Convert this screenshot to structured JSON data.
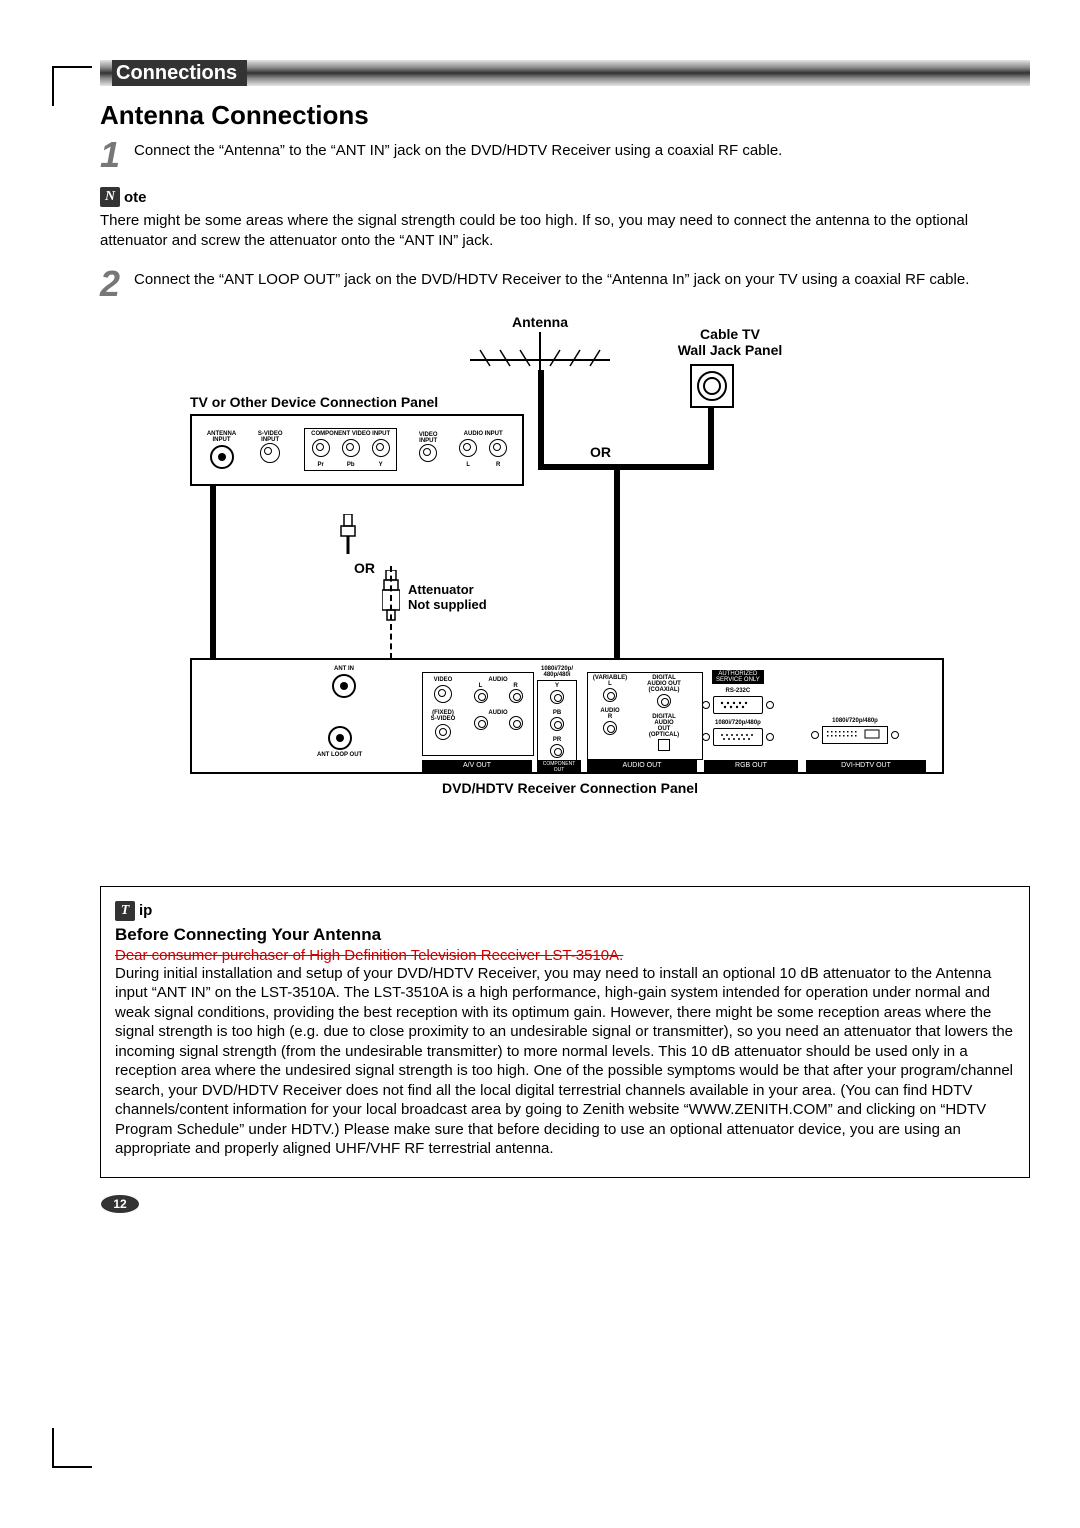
{
  "section_header": "Connections",
  "title": "Antenna Connections",
  "steps": [
    {
      "num": "1",
      "text": "Connect the “Antenna” to the “ANT IN” jack on the DVD/HDTV Receiver using a coaxial RF cable."
    },
    {
      "num": "2",
      "text": "Connect the “ANT LOOP OUT” jack on the DVD/HDTV Receiver to the “Antenna In” jack on your TV using a coaxial RF cable."
    }
  ],
  "note": {
    "icon": "N",
    "label": "ote",
    "text": "There might be some areas where the signal strength could be too high. If so, you may need to connect the antenna to the optional attenuator and screw the attenuator onto the “ANT IN” jack."
  },
  "diagram": {
    "antenna_label": "Antenna",
    "cable_tv_label": "Cable TV\nWall Jack Panel",
    "tv_panel_label": "TV or Other Device Connection Panel",
    "or_label": "OR",
    "attenuator_label": "Attenuator\nNot supplied",
    "receiver_label": "DVD/HDTV Receiver Connection Panel",
    "tv_panel": {
      "antenna_input": "ANTENNA\nINPUT",
      "svideo_input": "S-VIDEO\nINPUT",
      "component": "COMPONENT VIDEO INPUT",
      "component_labels": [
        "Pr",
        "Pb",
        "Y"
      ],
      "video_input": "VIDEO\nINPUT",
      "audio_input": "AUDIO INPUT",
      "audio_lr": [
        "L",
        "R"
      ]
    },
    "receiver_panel": {
      "ant_in": "ANT IN",
      "ant_loop_out": "ANT LOOP OUT",
      "video": "VIDEO",
      "fixed": "(FIXED)",
      "svideo": "S-VIDEO",
      "audio": "AUDIO",
      "y_pb_pr": [
        "Y",
        "PB",
        "PR"
      ],
      "res1": "1080i/720p/\n480p/480i",
      "variable": "(VARIABLE)",
      "audio2": "AUDIO",
      "l_r": [
        "L",
        "R"
      ],
      "digital_coax": "DIGITAL\nAUDIO OUT\n(COAXIAL)",
      "digital_opt": "DIGITAL\nAUDIO\nOUT\n(OPTICAL)",
      "authorized": "AUTHORIZED\nSERVICE ONLY",
      "rs232c": "RS-232C",
      "res2": "1080i/720p/480p",
      "res3": "1080i/720p/480p",
      "strip_av": "A/V OUT",
      "strip_comp": "COMPONENT\nOUT",
      "strip_audio": "AUDIO OUT",
      "strip_rgb": "RGB OUT",
      "strip_dvi": "DVI-HDTV OUT"
    }
  },
  "tip": {
    "icon": "T",
    "label": "ip",
    "heading": "Before Connecting Your Antenna",
    "strike": "Dear consumer purchaser of High Definition Television Receiver LST-3510A.",
    "body": "During initial installation and setup of your DVD/HDTV Receiver, you may need to install an optional 10 dB attenuator to the Antenna input “ANT IN” on the LST-3510A. The LST-3510A is a high performance, high-gain system intended for operation under normal and weak signal conditions, providing the best reception with its optimum gain. However, there might be some reception areas where the signal strength is too high (e.g. due to close proximity to an undesirable signal or transmitter), so you need an attenuator that lowers the incoming signal strength (from the undesirable transmitter) to more normal levels. This 10 dB attenuator should be used only in a reception area where the undesired signal strength is too high. One of the possible symptoms would be that after your program/channel search, your DVD/HDTV Receiver does not find all the local digital terrestrial channels available in your area. (You can find HDTV channels/content information for your local broadcast area by going to Zenith website “WWW.ZENITH.COM” and clicking on “HDTV Program Schedule” under HDTV.) Please make sure that before deciding to use an optional attenuator device, you are using an appropriate and properly aligned UHF/VHF RF terrestrial antenna."
  },
  "page_number": "12"
}
